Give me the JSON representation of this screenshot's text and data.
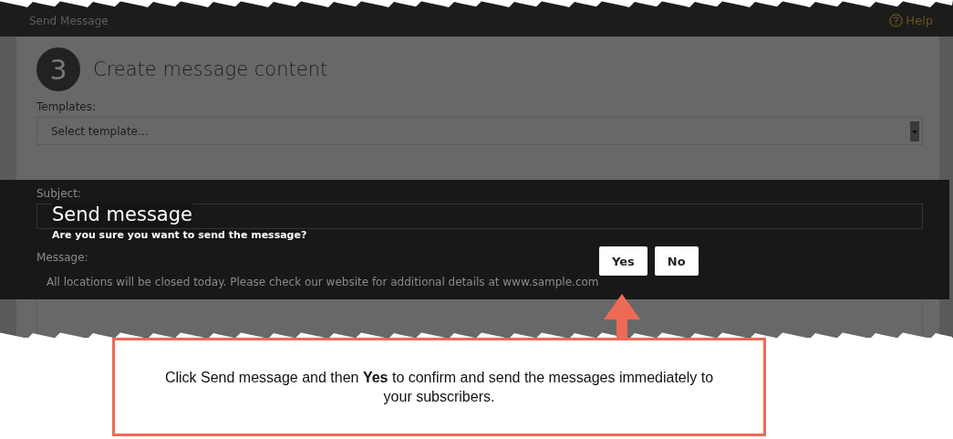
{
  "window": {
    "title": "Send Message",
    "help": "Help"
  },
  "step": {
    "number": "3",
    "title": "Create message content"
  },
  "templates": {
    "label": "Templates:",
    "value": "Select template..."
  },
  "subject": {
    "label": "Subject:"
  },
  "message": {
    "label": "Message:",
    "value": "All locations will be closed today. Please check our website for additional details at www.sample.com"
  },
  "dialog": {
    "title": "Send message",
    "text": "Are you sure you want to send the message?",
    "buttons": [
      "Yes",
      "No"
    ]
  },
  "callout": {
    "text": "Click Send message and then **Yes** to confirm and send the messages immediately to your subscribers."
  }
}
